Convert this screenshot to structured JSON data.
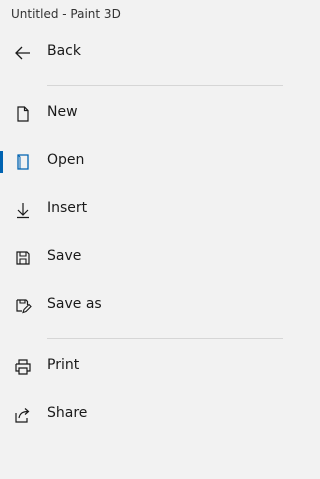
{
  "window": {
    "title": "Untitled - Paint 3D"
  },
  "menu": {
    "back": {
      "label": "Back",
      "icon": "back-arrow-icon"
    },
    "items": [
      {
        "label": "New",
        "icon": "new-document-icon"
      },
      {
        "label": "Open",
        "icon": "open-document-icon",
        "selected": true
      },
      {
        "label": "Insert",
        "icon": "insert-arrow-icon"
      },
      {
        "label": "Save",
        "icon": "save-floppy-icon"
      },
      {
        "label": "Save as",
        "icon": "save-as-icon"
      }
    ],
    "secondary": [
      {
        "label": "Print",
        "icon": "printer-icon"
      },
      {
        "label": "Share",
        "icon": "share-icon"
      }
    ]
  },
  "colors": {
    "accent": "#0063b1",
    "background": "#f2f2f2",
    "text": "#1a1a1a",
    "divider": "#d6d6d6"
  }
}
